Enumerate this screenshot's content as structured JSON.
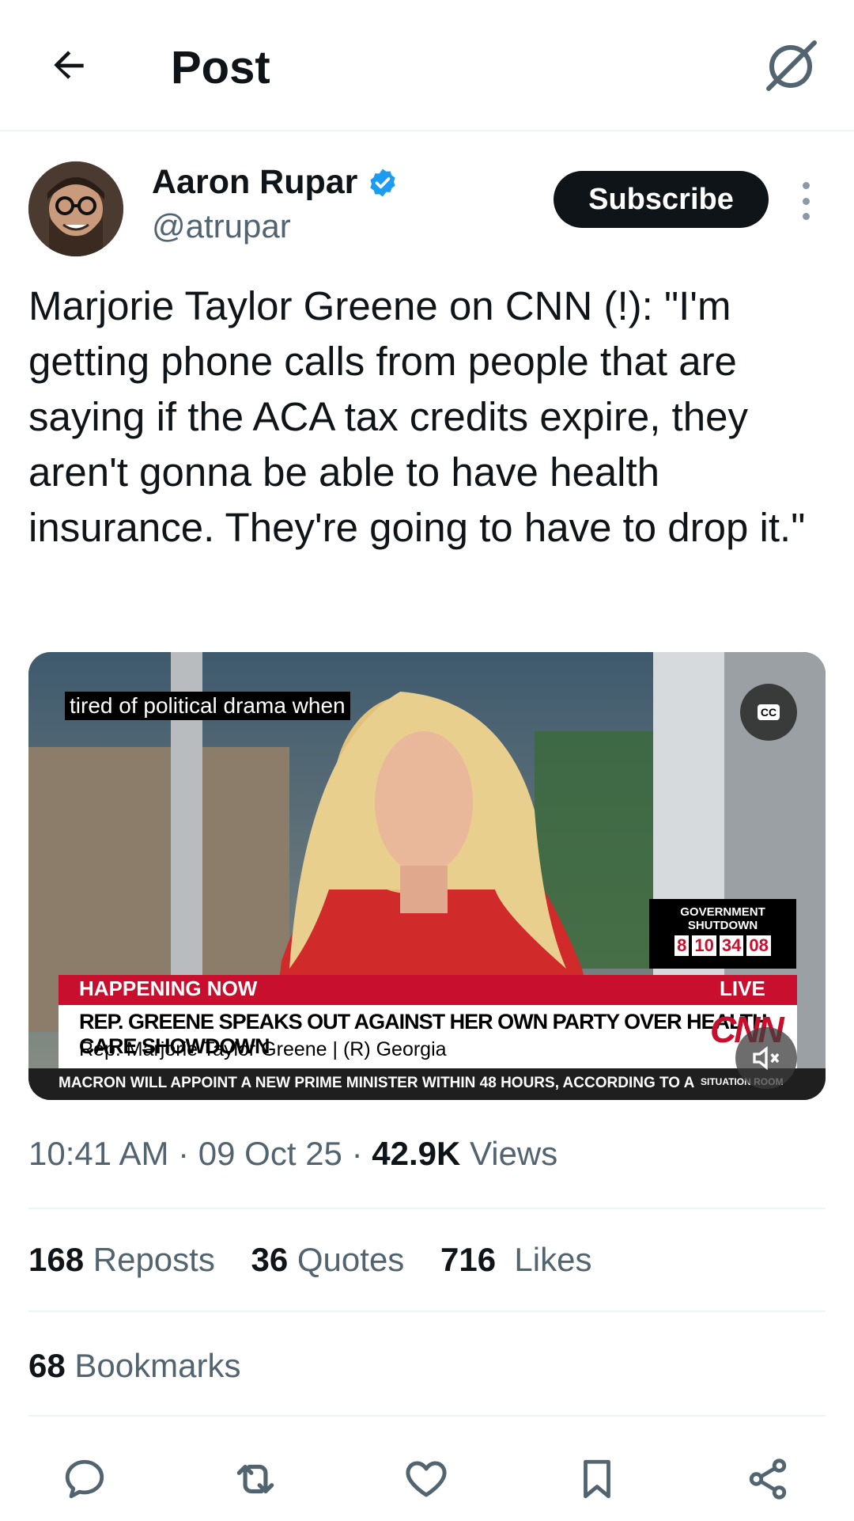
{
  "header": {
    "title": "Post",
    "back_icon": "arrow-left-icon",
    "grok_icon": "grok-icon"
  },
  "author": {
    "name": "Aaron Rupar",
    "handle": "@atrupar",
    "verified_icon": "verified-badge-icon",
    "verified_color": "#1d9bf0",
    "subscribe_label": "Subscribe"
  },
  "tweet": {
    "text": "Marjorie Taylor Greene on CNN (!): \"I'm getting phone calls from people that are saying if the ACA tax credits expire, they aren't gonna be able to have health insurance. They're going to have to drop it.\""
  },
  "video": {
    "caption": "tired of political drama when",
    "cc_label": "CC",
    "shutdown_title": "GOVERNMENT SHUTDOWN",
    "clock": [
      "8",
      "10",
      "34",
      "08"
    ],
    "happening_now": "HAPPENING NOW",
    "live": "LIVE",
    "headline": "REP. GREENE SPEAKS OUT AGAINST HER OWN PARTY OVER HEALTH CARE SHOWDOWN",
    "subline": "Rep. Marjorie Taylor Greene  |  (R) Georgia",
    "network": "CNN",
    "ticker": "MACRON WILL APPOINT A NEW PRIME MINISTER WITHIN 48 HOURS, ACCORDING TO A",
    "ticker_brand": "SITUATION ROOM"
  },
  "meta": {
    "time": "10:41 AM",
    "date": "09 Oct 25",
    "views_count": "42.9K",
    "views_label": "Views"
  },
  "stats": {
    "reposts_count": "168",
    "reposts_label": "Reposts",
    "quotes_count": "36",
    "quotes_label": "Quotes",
    "likes_count": "716",
    "likes_label": "Likes",
    "bookmarks_count": "68",
    "bookmarks_label": "Bookmarks"
  },
  "actions": [
    "reply-icon",
    "repost-icon",
    "like-icon",
    "bookmark-icon",
    "share-icon"
  ],
  "colors": {
    "text": "#0f1419",
    "secondary": "#536471",
    "divider": "#eff3f4",
    "cnn_red": "#c8102e"
  }
}
